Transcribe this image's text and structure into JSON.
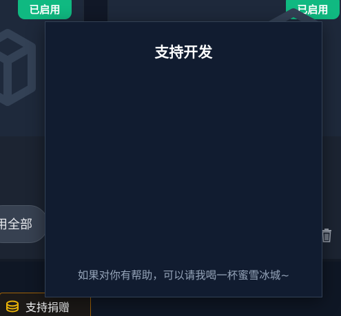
{
  "background": {
    "badge_left": "已启用",
    "badge_right": "已启用",
    "enable_all_label": "用全部",
    "donate_label": "支持捐赠"
  },
  "dialog": {
    "title": "支持开发",
    "footer": "如果对你有帮助，可以请我喝一杯蜜雪冰城~"
  },
  "colors": {
    "badge": "#10b981",
    "dialog_bg": "#111c30",
    "dialog_border": "#334155",
    "donate_border": "#a16207",
    "coin": "#eab308"
  }
}
